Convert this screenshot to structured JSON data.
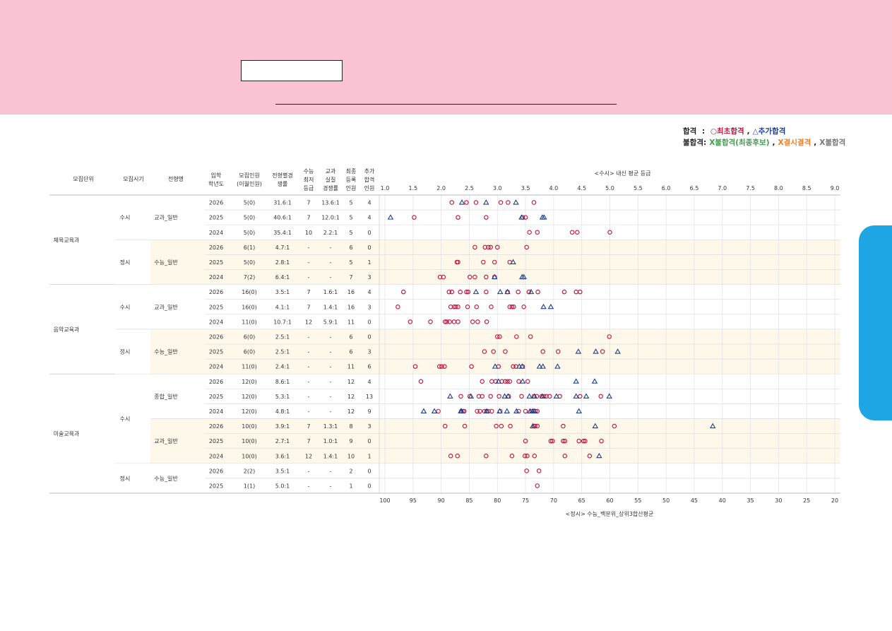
{
  "legend": {
    "pass_label": "합격",
    "pass_sep": " : ",
    "first_pass": "○최초합격",
    "add_pass": "△추가합격",
    "fail_label": "불합격:",
    "fail_waitlist": "X불합격(최종후보)",
    "fail_absent": "X결시결격",
    "fail_plain": "X불합격",
    "colors": {
      "first": "#c0123c",
      "add": "#1b3f8f",
      "waitlist": "#3aa14a",
      "absent": "#ef7d20",
      "fail": "#777777"
    }
  },
  "table": {
    "headers": {
      "unit": "모집단위",
      "period": "모집시기",
      "type": "전형명",
      "year": [
        "입학",
        "학년도"
      ],
      "quota": [
        "모집인원",
        "(이월인원)"
      ],
      "ratio": [
        "전형별경",
        "쟁률"
      ],
      "min": [
        "수능",
        "최저",
        "등급"
      ],
      "actual": [
        "교과",
        "실질",
        "경쟁률"
      ],
      "final": [
        "최종",
        "등록",
        "인원"
      ],
      "addpass": [
        "추가",
        "합격",
        "인원"
      ]
    },
    "groups": [
      {
        "unit": "체육교육과",
        "period": "수시",
        "type": "교과_일반",
        "shade": false,
        "rows": [
          0,
          1,
          2
        ]
      },
      {
        "unit": "체육교육과",
        "period": "정시",
        "type": "수능_일반",
        "shade": true,
        "rows": [
          3,
          4,
          5
        ]
      },
      {
        "unit": "음악교육과",
        "period": "수시",
        "type": "교과_일반",
        "shade": false,
        "rows": [
          6,
          7,
          8
        ]
      },
      {
        "unit": "음악교육과",
        "period": "정시",
        "type": "수능_일반",
        "shade": true,
        "rows": [
          9,
          10,
          11
        ]
      },
      {
        "unit": "미술교육과",
        "period": "수시",
        "type": "종합_일반",
        "shade": false,
        "rows": [
          12,
          13,
          14
        ]
      },
      {
        "unit": "미술교육과",
        "period": "수시",
        "type": "교과_일반",
        "shade": true,
        "rows": [
          15,
          16,
          17
        ]
      },
      {
        "unit": "미술교육과",
        "period": "정시",
        "type": "수능_일반",
        "shade": false,
        "rows": [
          18,
          19
        ]
      }
    ],
    "units": [
      {
        "name": "체육교육과",
        "rows": [
          0,
          5
        ]
      },
      {
        "name": "음악교육과",
        "rows": [
          6,
          11
        ]
      },
      {
        "name": "미술교육과",
        "rows": [
          12,
          19
        ]
      }
    ],
    "periods": [
      {
        "name": "수시",
        "rows": [
          0,
          2
        ]
      },
      {
        "name": "정시",
        "rows": [
          3,
          5
        ]
      },
      {
        "name": "수시",
        "rows": [
          6,
          8
        ]
      },
      {
        "name": "정시",
        "rows": [
          9,
          11
        ]
      },
      {
        "name": "수시",
        "rows": [
          12,
          17
        ]
      },
      {
        "name": "정시",
        "rows": [
          18,
          19
        ]
      }
    ],
    "rows": [
      {
        "year": "2026",
        "quota": "5(0)",
        "ratio": "31.6:1",
        "min": "7",
        "actual": "13.6:1",
        "final": "5",
        "add": "4"
      },
      {
        "year": "2025",
        "quota": "5(0)",
        "ratio": "40.6:1",
        "min": "7",
        "actual": "12.0:1",
        "final": "5",
        "add": "4"
      },
      {
        "year": "2024",
        "quota": "5(0)",
        "ratio": "35.4:1",
        "min": "10",
        "actual": "2.2:1",
        "final": "5",
        "add": "0"
      },
      {
        "year": "2026",
        "quota": "6(1)",
        "ratio": "4.7:1",
        "min": "-",
        "actual": "-",
        "final": "6",
        "add": "0"
      },
      {
        "year": "2025",
        "quota": "5(0)",
        "ratio": "2.8:1",
        "min": "-",
        "actual": "-",
        "final": "5",
        "add": "1"
      },
      {
        "year": "2024",
        "quota": "7(2)",
        "ratio": "6.4:1",
        "min": "-",
        "actual": "-",
        "final": "7",
        "add": "3"
      },
      {
        "year": "2026",
        "quota": "16(0)",
        "ratio": "3.5:1",
        "min": "7",
        "actual": "1.6:1",
        "final": "16",
        "add": "4"
      },
      {
        "year": "2025",
        "quota": "16(0)",
        "ratio": "4.1:1",
        "min": "7",
        "actual": "1.4:1",
        "final": "16",
        "add": "3"
      },
      {
        "year": "2024",
        "quota": "11(0)",
        "ratio": "10.7:1",
        "min": "12",
        "actual": "5.9:1",
        "final": "11",
        "add": "0"
      },
      {
        "year": "2026",
        "quota": "6(0)",
        "ratio": "2.5:1",
        "min": "-",
        "actual": "-",
        "final": "6",
        "add": "0"
      },
      {
        "year": "2025",
        "quota": "6(0)",
        "ratio": "2.5:1",
        "min": "-",
        "actual": "-",
        "final": "6",
        "add": "3"
      },
      {
        "year": "2024",
        "quota": "11(0)",
        "ratio": "2.4:1",
        "min": "-",
        "actual": "-",
        "final": "11",
        "add": "6"
      },
      {
        "year": "2026",
        "quota": "12(0)",
        "ratio": "8.6:1",
        "min": "-",
        "actual": "-",
        "final": "12",
        "add": "4"
      },
      {
        "year": "2025",
        "quota": "12(0)",
        "ratio": "5.3:1",
        "min": "-",
        "actual": "-",
        "final": "12",
        "add": "13"
      },
      {
        "year": "2024",
        "quota": "12(0)",
        "ratio": "4.8:1",
        "min": "-",
        "actual": "-",
        "final": "12",
        "add": "9"
      },
      {
        "year": "2026",
        "quota": "10(0)",
        "ratio": "3.9:1",
        "min": "7",
        "actual": "1.3:1",
        "final": "8",
        "add": "3"
      },
      {
        "year": "2025",
        "quota": "10(0)",
        "ratio": "2.7:1",
        "min": "7",
        "actual": "1.0:1",
        "final": "9",
        "add": "0"
      },
      {
        "year": "2024",
        "quota": "10(0)",
        "ratio": "3.6:1",
        "min": "12",
        "actual": "1.4:1",
        "final": "10",
        "add": "1"
      },
      {
        "year": "2026",
        "quota": "2(2)",
        "ratio": "3.5:1",
        "min": "-",
        "actual": "-",
        "final": "2",
        "add": "0"
      },
      {
        "year": "2025",
        "quota": "1(1)",
        "ratio": "5.0:1",
        "min": "-",
        "actual": "-",
        "final": "1",
        "add": "0"
      }
    ]
  },
  "chart_data": {
    "type": "scatter",
    "top_axis_title": "<수시> 내신 평균 등급",
    "bottom_axis_title": "<정시> 수능_백분위_상위3합산평균",
    "top_ticks": [
      "1.0",
      "1.5",
      "2.0",
      "2.5",
      "3.0",
      "3.5",
      "4.0",
      "4.5",
      "5.0",
      "5.5",
      "6.0",
      "6.5",
      "7.0",
      "7.5",
      "8.0",
      "8.5",
      "9.0"
    ],
    "top_range": [
      1.0,
      9.0
    ],
    "bottom_ticks": [
      "100",
      "95",
      "90",
      "85",
      "80",
      "75",
      "70",
      "65",
      "60",
      "55",
      "50",
      "45",
      "40",
      "35",
      "30",
      "25",
      "20"
    ],
    "bottom_range": [
      100,
      20
    ],
    "marker_colors": {
      "first": "#c0123c",
      "add": "#1b3f8f"
    },
    "rows": [
      {
        "scale": "grade",
        "first": [
          2.19,
          2.45,
          2.62,
          3.06,
          3.19,
          3.65
        ],
        "add": [
          2.37,
          2.8,
          3.33
        ]
      },
      {
        "scale": "grade",
        "first": [
          1.52,
          2.3,
          2.8,
          3.45,
          3.5
        ],
        "add": [
          1.1,
          3.43,
          3.8,
          3.83
        ]
      },
      {
        "scale": "grade",
        "first": [
          3.57,
          3.71,
          4.33,
          4.42,
          5.0
        ],
        "add": []
      },
      {
        "scale": "pct",
        "first": [
          84,
          82.2,
          81.6,
          81.2,
          80,
          74.8
        ],
        "add": []
      },
      {
        "scale": "pct",
        "first": [
          87.2,
          87,
          82.5,
          80.5,
          77.8
        ],
        "add": [
          77.2
        ]
      },
      {
        "scale": "pct",
        "first": [
          90.2,
          89.6,
          84.9,
          84,
          82,
          80.5
        ],
        "add": [
          80.5,
          75.6,
          75.3
        ]
      },
      {
        "scale": "grade",
        "first": [
          1.33,
          2.14,
          2.19,
          2.34,
          2.45,
          2.48,
          2.8,
          3.18,
          3.37,
          3.56,
          3.72,
          4.19,
          4.4,
          4.47
        ],
        "add": [
          2.62,
          3.05,
          3.18,
          3.6
        ]
      },
      {
        "scale": "grade",
        "first": [
          1.23,
          2.17,
          2.23,
          2.26,
          2.3,
          2.47,
          2.63,
          2.89,
          3.22,
          3.26,
          3.29,
          3.47
        ],
        "add": [
          3.82,
          3.95
        ]
      },
      {
        "scale": "grade",
        "first": [
          1.45,
          1.81,
          2.07,
          2.1,
          2.15,
          2.23,
          2.3,
          2.56,
          2.65,
          2.81
        ],
        "add": []
      },
      {
        "scale": "pct",
        "first": [
          80,
          79.6,
          76.6,
          74.1,
          60.1
        ],
        "add": []
      },
      {
        "scale": "pct",
        "first": [
          82.3,
          80.7,
          78.6,
          71.9,
          69.2,
          61.3
        ],
        "add": [
          65.6,
          62.5,
          58.6
        ]
      },
      {
        "scale": "pct",
        "first": [
          94.6,
          90.3,
          89.9,
          89.4,
          84.6,
          79.8,
          77.2,
          76.7,
          75.5
        ],
        "add": [
          80.4,
          76.1,
          75.6,
          72.5,
          71.9,
          69.3
        ]
      },
      {
        "scale": "pct",
        "first": [
          93.6,
          82.7,
          81,
          80.3,
          79.2,
          78.6,
          78.2,
          77.8,
          76.2,
          74.6
        ],
        "add": [
          79.8,
          75.5,
          66,
          62.7
        ]
      },
      {
        "scale": "pct",
        "first": [
          86.5,
          84.9,
          83.3,
          82.7,
          81.2,
          79.7,
          78,
          75.7,
          73.5,
          73,
          72.1,
          71.7,
          71.3,
          70.7,
          68.9,
          65.3,
          61.6
        ],
        "add": [
          88.4,
          84.7,
          78.7,
          78.1,
          74.3,
          73.4,
          72,
          69.5,
          66,
          64.2,
          60.1
        ]
      },
      {
        "scale": "pct",
        "first": [
          90.5,
          86.4,
          86.1,
          85.9,
          83.6,
          83.1,
          82.3,
          81.9,
          81.6,
          81,
          79.5,
          76.2,
          75,
          73.9,
          73.5,
          73.2,
          72.9
        ],
        "add": [
          93.1,
          91.2,
          86.5,
          86.4,
          81.9,
          79.6,
          78.3,
          76.6,
          74.2,
          73.7,
          73.4,
          65.5
        ]
      },
      {
        "scale": "grade",
        "first": [
          2.07,
          2.42,
          2.98,
          3.07,
          3.23,
          3.65,
          3.67,
          3.71,
          4.17,
          5.08
        ],
        "add": [
          3.63,
          4.74,
          6.83
        ]
      },
      {
        "scale": "grade",
        "first": [
          3.5,
          3.95,
          3.98,
          4.17,
          4.2,
          4.45,
          4.53,
          4.56,
          4.85
        ],
        "add": []
      },
      {
        "scale": "grade",
        "first": [
          2.17,
          2.29,
          2.8,
          3.26,
          3.49,
          3.53,
          3.66,
          4.2,
          4.64
        ],
        "add": [
          4.81
        ]
      },
      {
        "scale": "pct",
        "first": [
          74.8,
          72.6
        ],
        "add": []
      },
      {
        "scale": "pct",
        "first": [
          72.9
        ],
        "add": []
      }
    ]
  }
}
